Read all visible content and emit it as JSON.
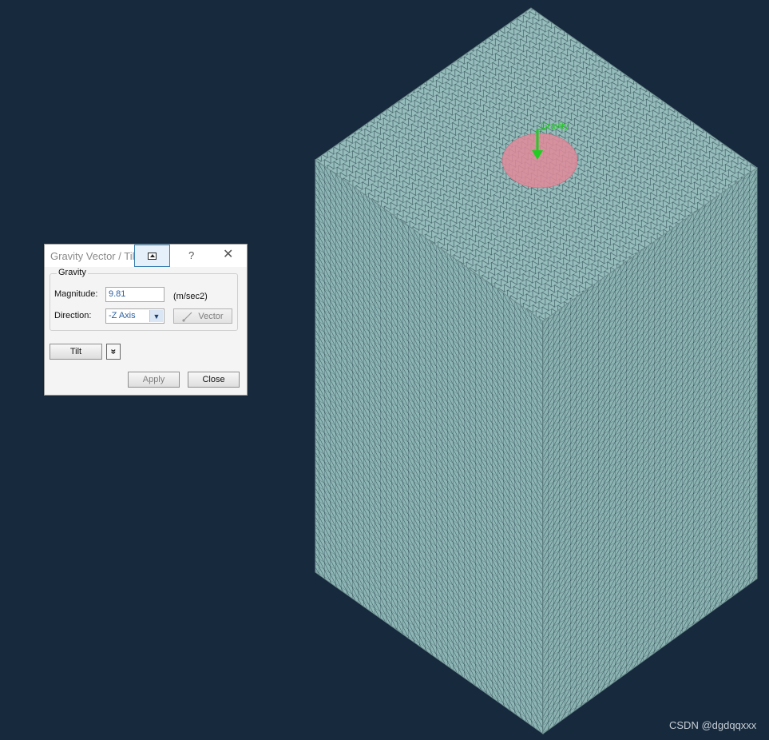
{
  "dialog": {
    "title": "Gravity Vector / Tilt",
    "help_glyph": "?",
    "close_glyph": "✕",
    "group_title": "Gravity",
    "magnitude_label": "Magnitude:",
    "magnitude_value": "9.81",
    "magnitude_unit": "(m/sec2)",
    "direction_label": "Direction:",
    "direction_value": "-Z Axis",
    "vector_button": "Vector",
    "tilt_button": "Tilt",
    "expand_glyph": "»",
    "apply_button": "Apply",
    "close_button": "Close"
  },
  "viewport": {
    "gravity_label": "Gravity",
    "background_color": "#172a3d",
    "mesh_color": "#93b9b9",
    "marker_color": "#e08a9a",
    "arrow_color": "#22cc22"
  },
  "watermark": "CSDN @dgdqqxxx"
}
